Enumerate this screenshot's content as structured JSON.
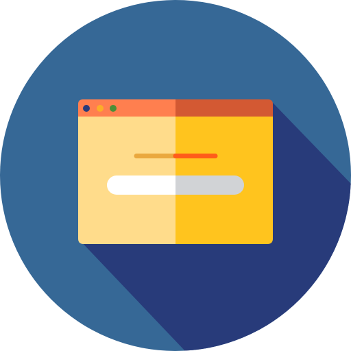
{
  "icon": {
    "name": "browser-login-window-icon",
    "colors": {
      "circle": "#366896",
      "long_shadow": "#283B7A",
      "titlebar_light": "#FF7F4F",
      "titlebar_dark": "#D35933",
      "panel_light": "#FFDC8B",
      "panel_dark": "#FFC41E",
      "dot_1": "#283B7A",
      "dot_2": "#FCAD29",
      "dot_3": "#4C8F37",
      "label_line_light": "#EAA83E",
      "label_line_dark": "#FF5C1A",
      "input_light": "#FFFFFF",
      "input_dark": "#D1D3D6"
    }
  }
}
